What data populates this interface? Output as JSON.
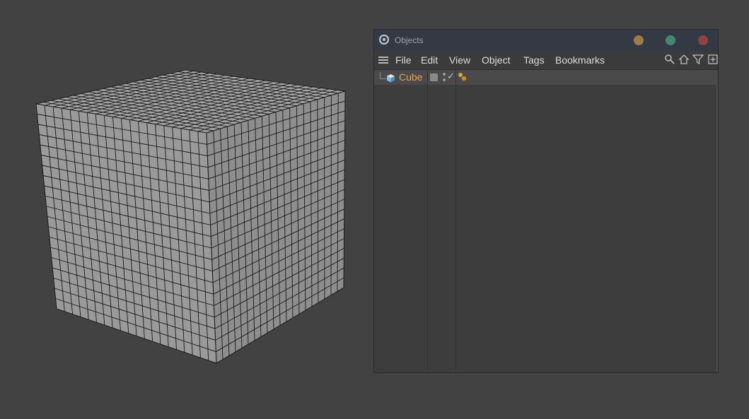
{
  "viewport": {
    "object": "Cube",
    "mesh_color": "#9a9a9a",
    "wire_color": "#1a1a1a",
    "subdivisions": 20
  },
  "objects_panel": {
    "title": "Objects",
    "window_buttons": [
      "minimize-button",
      "maximize-button",
      "close-button"
    ],
    "menu": [
      {
        "label": "File"
      },
      {
        "label": "Edit"
      },
      {
        "label": "View"
      },
      {
        "label": "Object"
      },
      {
        "label": "Tags"
      },
      {
        "label": "Bookmarks"
      }
    ],
    "tools": [
      "search-icon",
      "home-icon",
      "filter-icon",
      "new-window-icon"
    ],
    "tree": [
      {
        "name": "Cube",
        "icon": "cube-icon",
        "selected": true,
        "name_color": "#f0a43a"
      }
    ]
  }
}
